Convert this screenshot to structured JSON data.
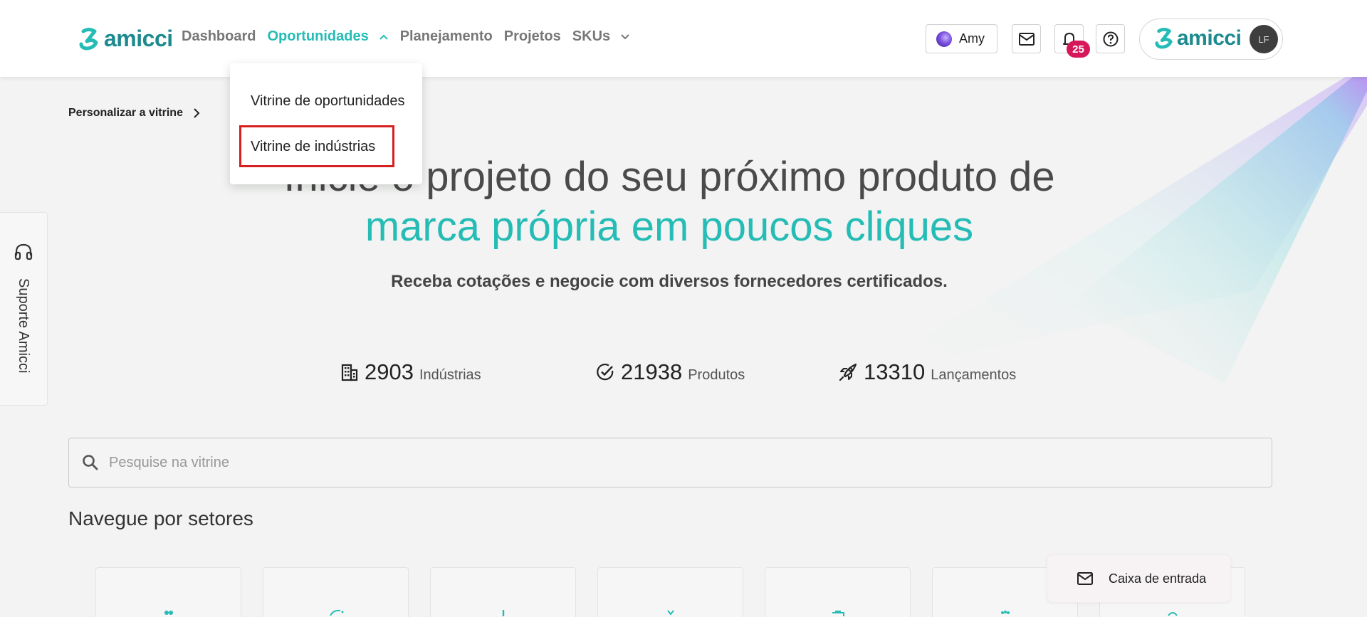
{
  "header": {
    "logo_text": "amicci",
    "nav": [
      {
        "label": "Dashboard"
      },
      {
        "label": "Oportunidades"
      },
      {
        "label": "Planejamento"
      },
      {
        "label": "Projetos"
      },
      {
        "label": "SKUs"
      }
    ],
    "amy_label": "Amy",
    "notification_count": "25",
    "account_logo_text": "amicci",
    "avatar_initials": "LF"
  },
  "dropdown": {
    "items": [
      {
        "label": "Vitrine de oportunidades"
      },
      {
        "label": "Vitrine de indústrias"
      }
    ]
  },
  "breadcrumb": {
    "label": "Personalizar a vitrine"
  },
  "hero": {
    "line1": "Inicie o projeto do seu próximo produto de",
    "line2": "marca própria em poucos cliques",
    "subtitle": "Receba cotações e negocie com diversos fornecedores certificados."
  },
  "stats": [
    {
      "value": "2903",
      "label": "Indústrias",
      "icon": "building-icon"
    },
    {
      "value": "21938",
      "label": "Produtos",
      "icon": "check-circle-icon"
    },
    {
      "value": "13310",
      "label": "Lançamentos",
      "icon": "rocket-icon"
    }
  ],
  "search": {
    "placeholder": "Pesquise na vitrine",
    "value": ""
  },
  "sectors": {
    "title": "Navegue por setores"
  },
  "inbox": {
    "label": "Caixa de entrada"
  },
  "support": {
    "label": "Suporte Amicci"
  },
  "colors": {
    "accent": "#26bcb6",
    "brand": "#1d8a8f",
    "badge": "#d6185a",
    "highlight": "#d61f1f"
  }
}
